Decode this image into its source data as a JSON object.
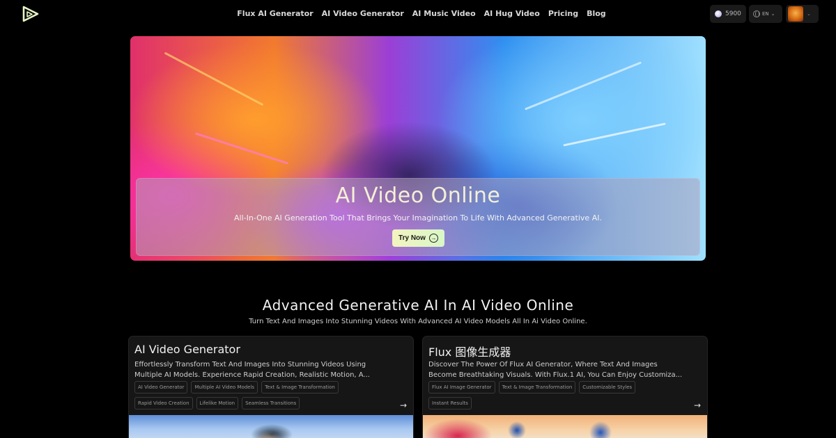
{
  "header": {
    "nav": [
      "Flux AI Generator",
      "AI Video Generator",
      "AI Music Video",
      "AI Hug Video",
      "Pricing",
      "Blog"
    ],
    "credits": "5900",
    "language": "EN"
  },
  "hero": {
    "title": "AI Video Online",
    "subtitle": "All-In-One AI Generation Tool That Brings Your Imagination To Life With Advanced Generative AI.",
    "cta": "Try Now"
  },
  "section": {
    "title": "Advanced Generative AI In AI Video Online",
    "subtitle": "Turn Text And Images Into Stunning Videos With Advanced AI Video Models All In Ai Video Online."
  },
  "cards": [
    {
      "title": "AI Video Generator",
      "description": "Effortlessly Transform Text And Images Into Stunning Videos Using Multiple AI Models. Experience Rapid Creation, Realistic Motion, A...",
      "tags": [
        "AI Video Generator",
        "Multiple AI Video Models",
        "Text & Image Transformation",
        "Rapid Video Creation",
        "Lifelike Motion",
        "Seamless Transitions"
      ]
    },
    {
      "title": "Flux 图像生成器",
      "description": "Discover The Power Of Flux AI Generator, Where Text And Images Become Breathtaking Visuals. With Flux.1 AI, You Can Enjoy Customiza...",
      "tags": [
        "Flux AI Image Generator",
        "Text & Image Transformation",
        "Customizable Styles",
        "Instant Results"
      ]
    }
  ],
  "colors": {
    "background": "#000000",
    "card": "#161616",
    "cta": "#e6f5c4",
    "hero_title": "#f4f0d6"
  },
  "icons": {
    "logo": "play-triangle-logo",
    "credits": "credit-dot-icon",
    "language": "globe-icon",
    "cta": "arrow-circle-right-icon",
    "card_link": "arrow-right-icon"
  }
}
